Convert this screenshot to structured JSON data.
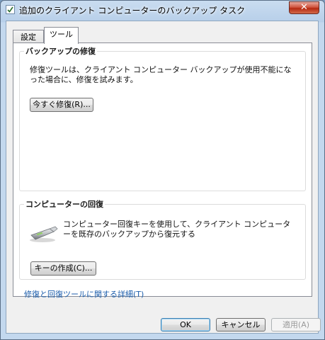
{
  "window": {
    "title": "追加のクライアント コンピューターのバックアップ タスク",
    "close_label": "✕"
  },
  "tabs": [
    {
      "label": "設定",
      "selected": false
    },
    {
      "label": "ツール",
      "selected": true
    }
  ],
  "repair_group": {
    "title": "バックアップの修復",
    "description": "修復ツールは、クライアント コンピューター バックアップが使用不能になった場合に、修復を試みます。",
    "button_label": "今すぐ修復(R)..."
  },
  "recovery_group": {
    "title": "コンピューターの回復",
    "description": "コンピューター回復キーを使用して、クライアント コンピューターを既存のバックアップから復元する",
    "icon": "usb-drive-icon",
    "button_label": "キーの作成(C)..."
  },
  "details_link": "修復と回復ツールに関する詳細(T)",
  "footer": {
    "ok_label": "OK",
    "cancel_label": "キャンセル",
    "apply_label": "適用(A)"
  }
}
